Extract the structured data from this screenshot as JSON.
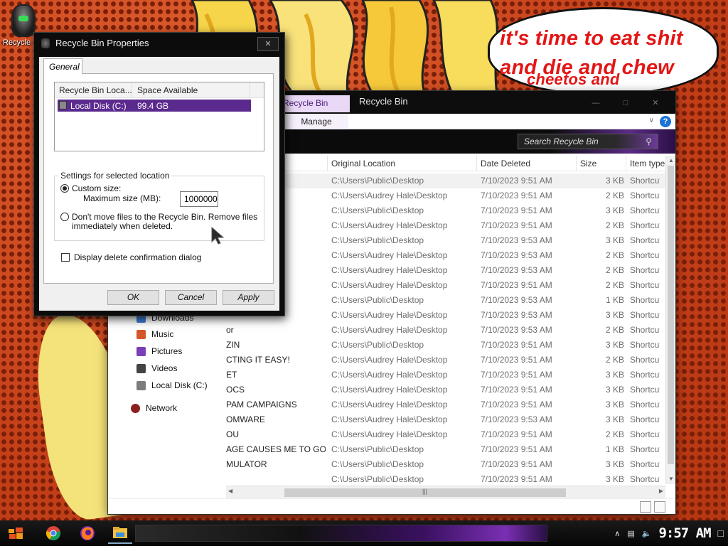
{
  "desktop": {
    "recycle_icon_label": "Recycle",
    "speech_line1": "it's time to eat shit",
    "speech_line2": "and die and chew",
    "speech_line3": "cheetos and"
  },
  "explorer": {
    "tools_tab": "Recycle Bin Tools",
    "title": "Recycle Bin",
    "ribbon_tab": "Manage",
    "search_placeholder": "Search Recycle Bin",
    "columns": [
      "Original Location",
      "Date Deleted",
      "Size",
      "Item type"
    ],
    "nav": [
      {
        "label": "Downloads",
        "icon": "downloads-icon"
      },
      {
        "label": "Music",
        "icon": "music-icon"
      },
      {
        "label": "Pictures",
        "icon": "pictures-icon"
      },
      {
        "label": "Videos",
        "icon": "videos-icon"
      },
      {
        "label": "Local Disk (C:)",
        "icon": "local-disk-icon"
      },
      {
        "label": "Network",
        "icon": "network-icon"
      }
    ],
    "rows": [
      {
        "name": "",
        "location": "C:\\Users\\Public\\Desktop",
        "date": "7/10/2023 9:51 AM",
        "size": "3 KB",
        "type": "Shortcut"
      },
      {
        "name": "",
        "location": "C:\\Users\\Audrey Hale\\Desktop",
        "date": "7/10/2023 9:51 AM",
        "size": "2 KB",
        "type": "Shortcut"
      },
      {
        "name": "",
        "location": "C:\\Users\\Public\\Desktop",
        "date": "7/10/2023 9:51 AM",
        "size": "3 KB",
        "type": "Shortcut"
      },
      {
        "name": "",
        "location": "C:\\Users\\Audrey Hale\\Desktop",
        "date": "7/10/2023 9:51 AM",
        "size": "2 KB",
        "type": "Shortcut"
      },
      {
        "name": "",
        "location": "C:\\Users\\Public\\Desktop",
        "date": "7/10/2023 9:53 AM",
        "size": "3 KB",
        "type": "Shortcut"
      },
      {
        "name": "",
        "location": "C:\\Users\\Audrey Hale\\Desktop",
        "date": "7/10/2023 9:53 AM",
        "size": "2 KB",
        "type": "Shortcut"
      },
      {
        "name": "",
        "location": "C:\\Users\\Audrey Hale\\Desktop",
        "date": "7/10/2023 9:53 AM",
        "size": "2 KB",
        "type": "Shortcut"
      },
      {
        "name": "",
        "location": "C:\\Users\\Audrey Hale\\Desktop",
        "date": "7/10/2023 9:51 AM",
        "size": "2 KB",
        "type": "Shortcut"
      },
      {
        "name": "",
        "location": "C:\\Users\\Public\\Desktop",
        "date": "7/10/2023 9:53 AM",
        "size": "1 KB",
        "type": "Shortcut"
      },
      {
        "name": "",
        "location": "C:\\Users\\Audrey Hale\\Desktop",
        "date": "7/10/2023 9:53 AM",
        "size": "3 KB",
        "type": "Shortcut"
      },
      {
        "name": "or",
        "location": "C:\\Users\\Audrey Hale\\Desktop",
        "date": "7/10/2023 9:53 AM",
        "size": "2 KB",
        "type": "Shortcut"
      },
      {
        "name": "ZIN",
        "location": "C:\\Users\\Public\\Desktop",
        "date": "7/10/2023 9:51 AM",
        "size": "3 KB",
        "type": "Shortcut"
      },
      {
        "name": "CTING IT EASY!",
        "location": "C:\\Users\\Audrey Hale\\Desktop",
        "date": "7/10/2023 9:51 AM",
        "size": "2 KB",
        "type": "Shortcut"
      },
      {
        "name": "ET",
        "location": "C:\\Users\\Audrey Hale\\Desktop",
        "date": "7/10/2023 9:51 AM",
        "size": "3 KB",
        "type": "Shortcut"
      },
      {
        "name": "OCS",
        "location": "C:\\Users\\Audrey Hale\\Desktop",
        "date": "7/10/2023 9:51 AM",
        "size": "3 KB",
        "type": "Shortcut"
      },
      {
        "name": "PAM CAMPAIGNS",
        "location": "C:\\Users\\Audrey Hale\\Desktop",
        "date": "7/10/2023 9:51 AM",
        "size": "3 KB",
        "type": "Shortcut"
      },
      {
        "name": "OMWARE",
        "location": "C:\\Users\\Audrey Hale\\Desktop",
        "date": "7/10/2023 9:53 AM",
        "size": "3 KB",
        "type": "Shortcut"
      },
      {
        "name": "OU",
        "location": "C:\\Users\\Audrey Hale\\Desktop",
        "date": "7/10/2023 9:51 AM",
        "size": "2 KB",
        "type": "Shortcut"
      },
      {
        "name": "AGE CAUSES ME TO GO IN...",
        "location": "C:\\Users\\Public\\Desktop",
        "date": "7/10/2023 9:51 AM",
        "size": "1 KB",
        "type": "Shortcut"
      },
      {
        "name": "MULATOR",
        "location": "C:\\Users\\Public\\Desktop",
        "date": "7/10/2023 9:51 AM",
        "size": "3 KB",
        "type": "Shortcut"
      },
      {
        "name": "",
        "location": "C:\\Users\\Public\\Desktop",
        "date": "7/10/2023 9:51 AM",
        "size": "3 KB",
        "type": "Shortcut"
      }
    ]
  },
  "dialog": {
    "title": "Recycle Bin Properties",
    "tab": "General",
    "list_columns": [
      "Recycle Bin Loca...",
      "Space Available"
    ],
    "list_row": {
      "location": "Local Disk (C:)",
      "space": "99.4 GB"
    },
    "group_label": "Settings for selected location",
    "custom_size_label": "Custom size:",
    "max_size_label": "Maximum size (MB):",
    "max_size_value": "1000000",
    "dont_move_label_1": "Don't move files to the Recycle Bin. Remove files",
    "dont_move_label_2": "immediately when deleted.",
    "confirm_label": "Display delete confirmation dialog",
    "buttons": {
      "ok": "OK",
      "cancel": "Cancel",
      "apply": "Apply"
    },
    "custom_size_selected": true,
    "confirm_checked": false
  },
  "taskbar": {
    "clock": "9:57 AM",
    "apps": [
      "chrome-icon",
      "firefox-icon",
      "file-explorer-icon"
    ]
  },
  "colors": {
    "accent_purple": "#5b2a8e",
    "speech_red": "#e31616"
  }
}
